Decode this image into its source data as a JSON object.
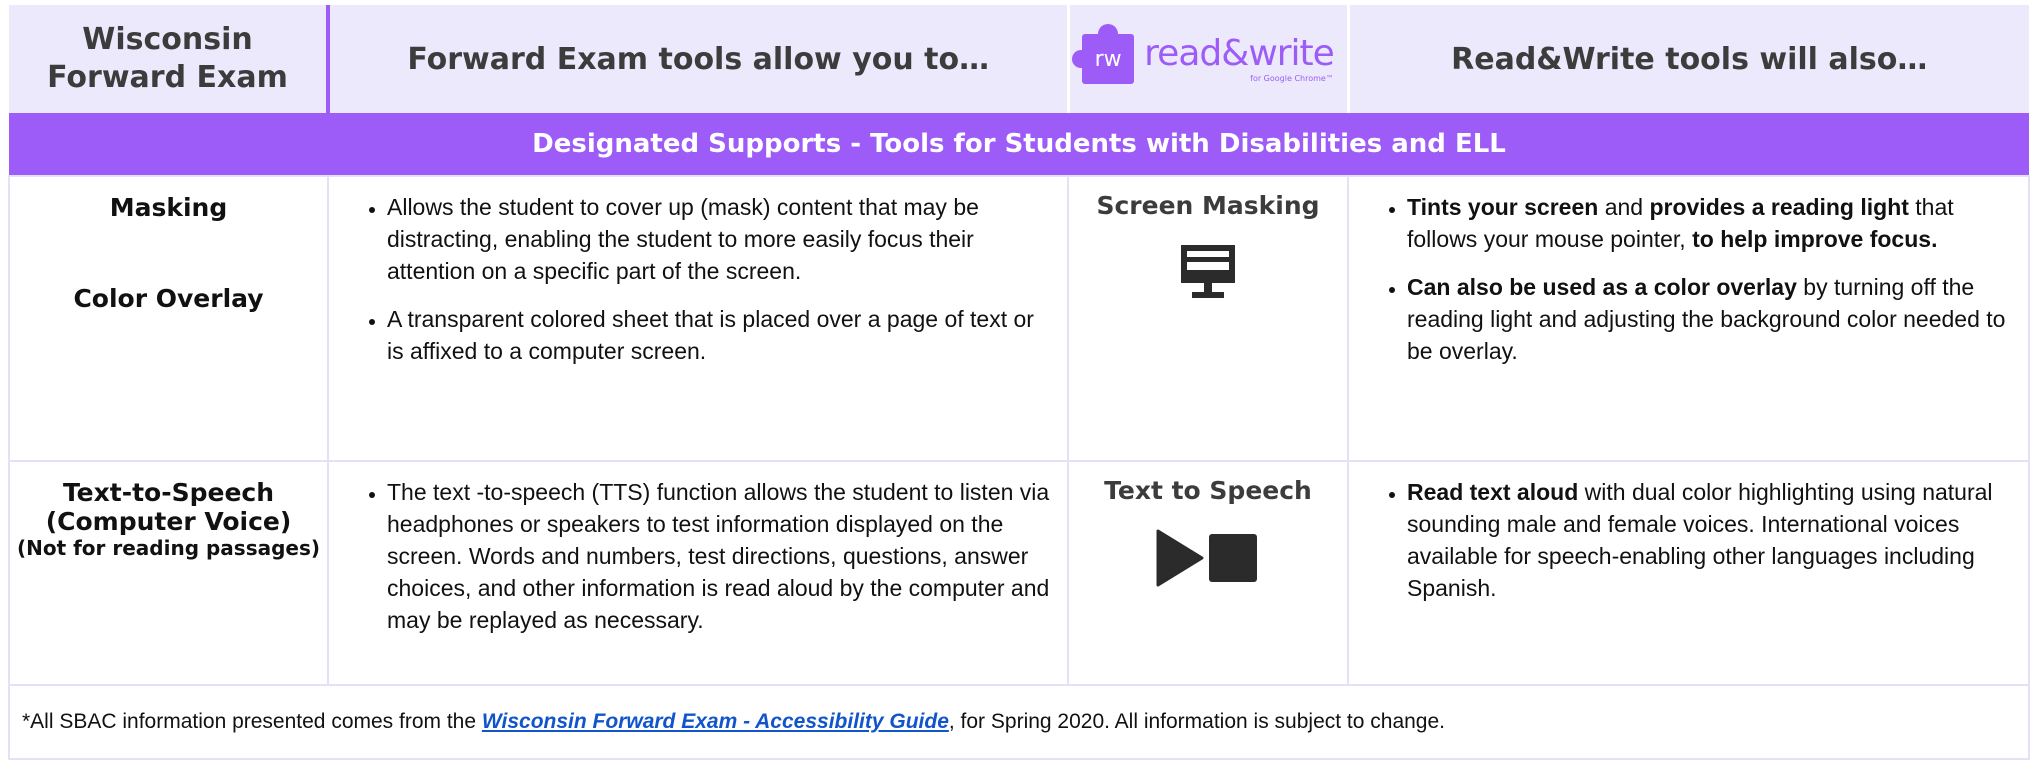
{
  "header": {
    "col1": [
      "Wisconsin",
      "Forward Exam"
    ],
    "col2": "Forward Exam tools allow you to…",
    "logo": {
      "mark": "rw",
      "name": "read&write",
      "sub": "for Google Chrome™"
    },
    "col4": "Read&Write tools will also…"
  },
  "banner": "Designated Supports - Tools for Students with Disabilities and ELL",
  "rows": [
    {
      "left": [
        "Masking",
        "Color Overlay"
      ],
      "forward": [
        "Allows the student to cover up (mask) content that may be distracting, enabling the student to more easily focus their attention on a specific part of  the screen.",
        "A transparent colored sheet that is placed over a page of text or is affixed to a computer screen."
      ],
      "tool": {
        "title": "Screen Masking",
        "icon": "screen-masking-icon"
      },
      "rw": [
        {
          "b1": "Tints your screen",
          "t1": " and ",
          "b2": "provides a reading light",
          "t2": " that follows your mouse pointer, ",
          "b3": "to help improve focus."
        },
        {
          "b1": "Can also be used as a color overlay",
          "t1": " by turning off the reading light and adjusting the background color needed to be overlay."
        }
      ]
    },
    {
      "left": [
        "Text-to-Speech",
        "(Computer  Voice)",
        "(Not for reading passages)"
      ],
      "forward": [
        "The  text -to-speech (TTS) function allows the student to listen via headphones or speakers to test information displayed on the screen.  Words and numbers, test directions, questions, answer choices, and other information is read aloud by the computer and may be replayed as necessary."
      ],
      "tool": {
        "title": "Text to Speech",
        "icon": "play-stop-icon"
      },
      "rw": [
        {
          "b1": "Read text aloud",
          "t1": " with dual color highlighting using natural sounding male and female voices. International voices available for speech-enabling other languages including Spanish."
        }
      ]
    }
  ],
  "footer": {
    "prefix": "*All SBAC information presented comes from the ",
    "link": "Wisconsin Forward Exam -  Accessibility Guide",
    "suffix": ", for Spring 2020.  All information is subject to change."
  },
  "colors": {
    "accent": "#9d5cf7",
    "header_bg": "#ebe9fb",
    "border": "#e3e1f7",
    "link": "#1155cc"
  }
}
